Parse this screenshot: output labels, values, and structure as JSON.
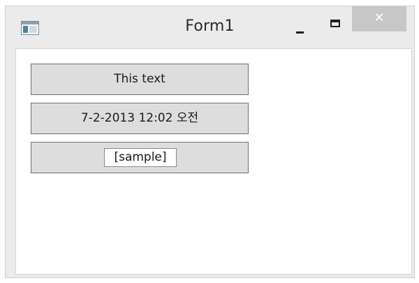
{
  "window": {
    "title": "Form1",
    "minimize_glyph": "",
    "maximize_glyph": "",
    "close_glyph": "✕"
  },
  "controls": {
    "text_box": "This text",
    "datetime_box": "7-2-2013 12:02 오전",
    "sample_box": "[sample]"
  },
  "icons": {
    "app": "window-app-icon",
    "minimize": "minimize-icon",
    "maximize": "maximize-icon",
    "close": "close-icon"
  },
  "colors": {
    "titlebar_bg": "#ebebeb",
    "close_button_bg": "#c7c7c7",
    "control_bg": "#dddddd",
    "control_border": "#707070"
  }
}
